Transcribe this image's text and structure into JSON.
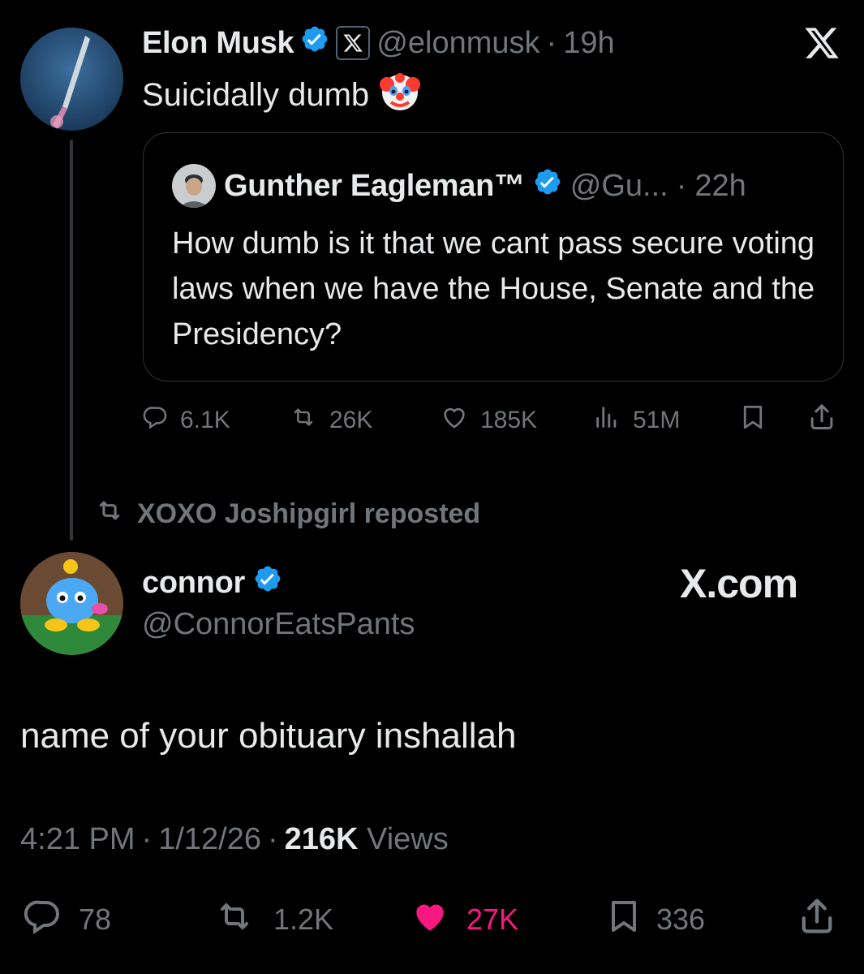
{
  "quoting_tweet": {
    "author_name": "Elon Musk",
    "handle": "@elonmusk",
    "separator": "·",
    "time": "19h",
    "text": "Suicidally dumb",
    "emoji": "🤡",
    "verified_color": "#1d9bf0",
    "quote": {
      "author_name": "Gunther Eagleman™",
      "handle": "@Gu...",
      "separator": "·",
      "time": "22h",
      "text": "How dumb is it that we cant pass secure voting laws when we have the House, Senate and the Presidency?"
    },
    "actions": {
      "replies": "6.1K",
      "reposts": "26K",
      "likes": "185K",
      "views": "51M"
    }
  },
  "repost_banner": {
    "text": "XOXO Joshipgirl reposted"
  },
  "reply_tweet": {
    "author_name": "connor",
    "handle": "@ConnorEatsPants",
    "watermark": "X.com",
    "text": "name of your obituary inshallah",
    "meta": {
      "time": "4:21 PM",
      "sep1": "·",
      "date": "1/12/26",
      "sep2": "·",
      "views_count": "216K",
      "views_label": "Views"
    },
    "actions": {
      "replies": "78",
      "reposts": "1.2K",
      "likes": "27K",
      "bookmarks": "336"
    },
    "like_color": "#f91880"
  },
  "icons": [
    "x-logo-icon",
    "verified-icon",
    "reply-icon",
    "repost-icon",
    "like-icon",
    "views-icon",
    "bookmark-icon",
    "share-icon"
  ]
}
